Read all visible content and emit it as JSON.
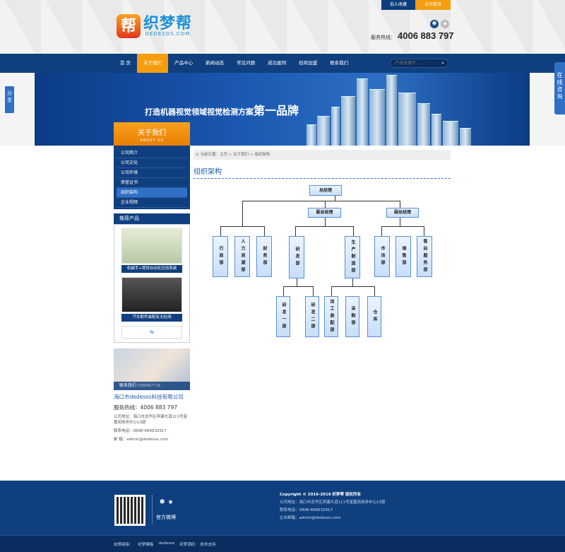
{
  "topbar": {
    "favorite": "加入收藏",
    "homepage": "设为首页"
  },
  "logo": {
    "mark": "帮",
    "cn": "织梦帮",
    "en": "DEDESOS.COM"
  },
  "hotline": {
    "label": "服务热线：",
    "number": "4006 883 797"
  },
  "nav": {
    "items": [
      "首 页",
      "关于我们",
      "产品中心",
      "新闻动态",
      "常见问题",
      "成功案例",
      "招商加盟",
      "联系我们"
    ],
    "active": 1,
    "search_placeholder": "产品关键字……"
  },
  "banner": {
    "title_prefix": "打造机器视觉领域视觉检测方案",
    "title_big": "第一品牌"
  },
  "share": "分享",
  "consult": "在线咨询",
  "sidebar": {
    "about_cn": "关于我们",
    "about_en": "ABOUT US",
    "menu": [
      "公司简介",
      "公司文化",
      "公司环境",
      "荣誉证书",
      "组织架构",
      "企业视频"
    ],
    "menu_active": 4,
    "rec_title": "推荐产品",
    "products": [
      "机械手+视觉自动化应用系统",
      "汽车配件装配有无检测"
    ],
    "more": "⇆",
    "contact_title": "联系我们",
    "contact_en": "CONTACT US",
    "company": "海口市dedesos科技有限公司",
    "phone": "服务热线：4006 883 797",
    "address": "公司地址：海口市龙华区滨濂大道111号富嘉苑商务中心13层",
    "tel": "联系电话：0898-666632917",
    "email": "邮  箱：admin@dedesos.com"
  },
  "breadcrumb": "当前位置：主页 > 关于我们 > 组织架构",
  "page_title": "组织架构",
  "org": {
    "ceo": "总经理",
    "vp1": "副总经理",
    "vp2": "副总经理",
    "d1": "行政部",
    "d2": "人力资源部",
    "d3": "财务部",
    "d4": "研发部",
    "d5": "生产制造部",
    "d6": "市场部",
    "d7": "销售部",
    "d8": "售后服务部",
    "s1": "研发一部",
    "s2": "研发二部",
    "s3": "加工装配部",
    "s4": "采购部",
    "s5": "仓库"
  },
  "footer": {
    "copyright": "Copyright © 2016-2016 织梦帮 版权所有",
    "address": "公司地址：海口市龙华区滨濂大道111号富嘉苑商务中心13层",
    "tel": "联系电话：0898-666632917",
    "email": "企业邮箱：admin@dedesos.com",
    "weibo": "官方微博",
    "links_label": "友情链接：",
    "links": [
      "织梦模板",
      "dedesos",
      "织梦源码",
      "技术支持"
    ]
  }
}
